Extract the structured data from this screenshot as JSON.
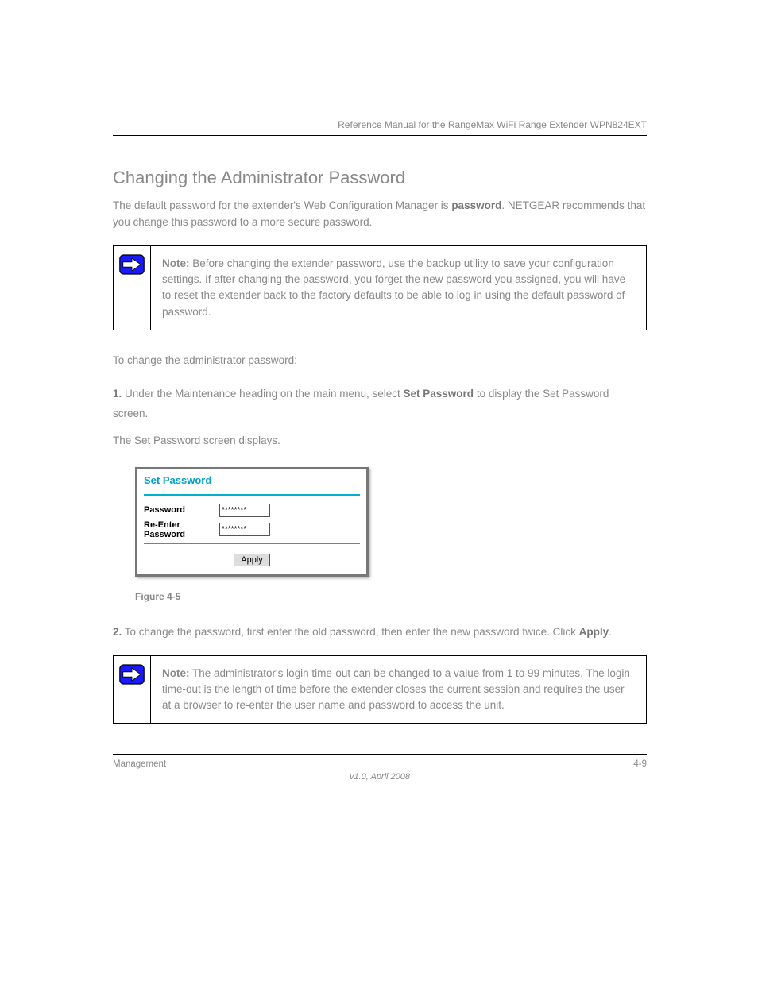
{
  "header": {
    "running_head": "Reference Manual for the RangeMax WiFi Range Extender WPN824EXT"
  },
  "section": {
    "title": "Changing the Administrator Password",
    "p1_before_bold": "The default password for the extender's Web Configuration Manager is ",
    "p1_bold": "password",
    "p1_after_bold": ". NETGEAR recommends that you change this password to a more secure password.",
    "note1_label": "Note:",
    "note1_text": " Before changing the extender password, use the backup utility to save your configuration settings. If after changing the password, you forget the new password you assigned, you will have to reset the extender back to the factory defaults to be able to log in using the default password of password.",
    "intro_line": "To change the administrator password:",
    "steps": [
      {
        "num": "1.",
        "text_before_bold": "Under the Maintenance heading on the main menu, select ",
        "bold": "Set Password",
        "text_after_bold": " to display the Set Password screen.",
        "sub": "The Set Password screen displays."
      }
    ],
    "panel": {
      "title": "Set Password",
      "password_label": "Password",
      "password_value": "********",
      "reenter_label": "Re-Enter Password",
      "reenter_value": "********",
      "apply_label": "Apply"
    },
    "figure_caption": "Figure 4-5",
    "step2": {
      "num": "2.",
      "text_before_bold": "To change the password, first enter the old password, then enter the new password twice. Click ",
      "bold": "Apply",
      "text_after_bold": "."
    },
    "note2_label": "Note:",
    "note2_text": " The administrator's login time-out can be changed to a value from 1 to 99 minutes. The login time-out is the length of time before the extender closes the current session and requires the user at a browser to re-enter the user name and password to access the unit."
  },
  "footer": {
    "left": "Management",
    "right": "4-9",
    "version": "v1.0, April 2008"
  }
}
